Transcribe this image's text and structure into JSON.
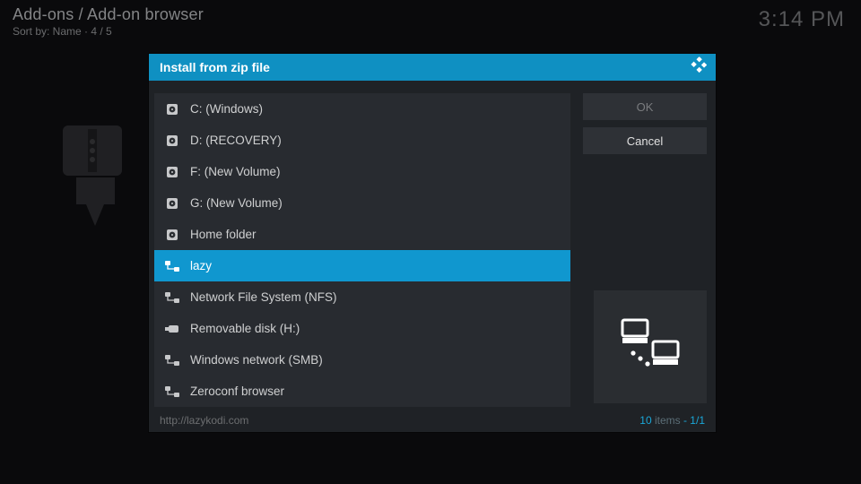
{
  "header": {
    "breadcrumb": "Add-ons / Add-on browser",
    "sort_by": "Sort by: Name  · 4 / 5"
  },
  "clock": "3:14 PM",
  "dialog": {
    "title": "Install from zip file",
    "items": [
      {
        "icon": "drive",
        "label": "C: (Windows)",
        "selected": false
      },
      {
        "icon": "drive",
        "label": "D: (RECOVERY)",
        "selected": false
      },
      {
        "icon": "drive",
        "label": "F: (New Volume)",
        "selected": false
      },
      {
        "icon": "drive",
        "label": "G: (New Volume)",
        "selected": false
      },
      {
        "icon": "drive",
        "label": "Home folder",
        "selected": false
      },
      {
        "icon": "net",
        "label": "lazy",
        "selected": true
      },
      {
        "icon": "net",
        "label": "Network File System (NFS)",
        "selected": false
      },
      {
        "icon": "usb",
        "label": "Removable disk (H:)",
        "selected": false
      },
      {
        "icon": "net",
        "label": "Windows network (SMB)",
        "selected": false
      },
      {
        "icon": "net",
        "label": "Zeroconf browser",
        "selected": false
      }
    ],
    "buttons": {
      "ok": "OK",
      "cancel": "Cancel"
    },
    "footer": {
      "path": "http://lazykodi.com",
      "count_num": "10",
      "count_word": " items",
      "page": " - 1/1"
    }
  }
}
